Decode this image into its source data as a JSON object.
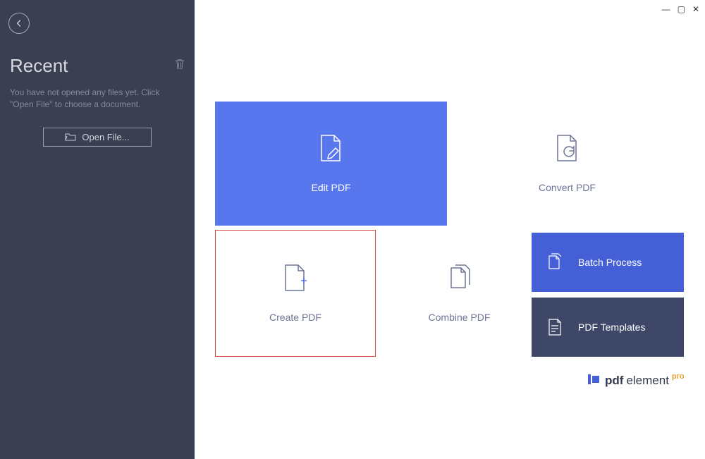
{
  "sidebar": {
    "recent_title": "Recent",
    "empty_message": "You have not opened any files yet. Click \"Open File\" to choose a document.",
    "open_file_label": "Open File..."
  },
  "window": {
    "minimize": "—",
    "maximize": "▢",
    "close": "✕"
  },
  "tiles": {
    "edit": "Edit PDF",
    "convert": "Convert PDF",
    "create": "Create PDF",
    "combine": "Combine PDF",
    "batch": "Batch Process",
    "templates": "PDF Templates"
  },
  "brand": {
    "pdf": "pdf",
    "element": "element",
    "pro": "pro"
  }
}
